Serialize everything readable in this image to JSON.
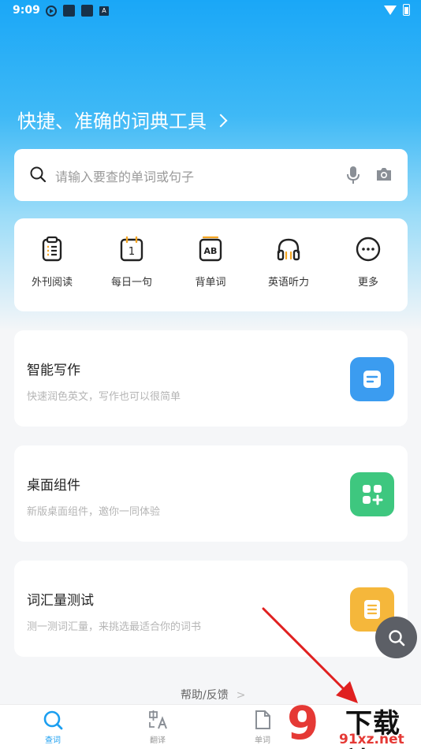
{
  "status_bar": {
    "time": "9:09",
    "mini_icon_letter": "A"
  },
  "headline": {
    "text": "快捷、准确的词典工具"
  },
  "search": {
    "placeholder": "请输入要查的单词或句子"
  },
  "quick_actions": [
    {
      "label": "外刊阅读",
      "icon": "newspaper-icon"
    },
    {
      "label": "每日一句",
      "icon": "calendar-icon",
      "icon_glyph": "1"
    },
    {
      "label": "背单词",
      "icon": "flashcard-icon",
      "icon_glyph": "AB"
    },
    {
      "label": "英语听力",
      "icon": "headphones-icon"
    },
    {
      "label": "更多",
      "icon": "more-icon"
    }
  ],
  "features": [
    {
      "title": "智能写作",
      "subtitle": "快速润色英文，写作也可以很简单",
      "icon": "document-icon",
      "color": "#3b9cf0"
    },
    {
      "title": "桌面组件",
      "subtitle": "新版桌面组件，邀你一同体验",
      "icon": "widget-grid-icon",
      "color": "#3ec77f"
    },
    {
      "title": "词汇量测试",
      "subtitle": "测一测词汇量，来挑选最适合你的词书",
      "icon": "list-icon",
      "color": "#f5b73b"
    }
  ],
  "help": {
    "label": "帮助/反馈",
    "arrow": ">"
  },
  "bottom_nav": [
    {
      "label": "查词",
      "icon": "search-icon",
      "active": true
    },
    {
      "label": "翻译",
      "icon": "translate-icon",
      "active": false
    },
    {
      "label": "单词",
      "icon": "wordbook-icon",
      "active": false
    }
  ],
  "watermark": {
    "digits": "9",
    "text": "下载站",
    "url": "91xz.net"
  },
  "colors": {
    "accent": "#1a9ef0",
    "header_top": "#1aa7f7"
  }
}
